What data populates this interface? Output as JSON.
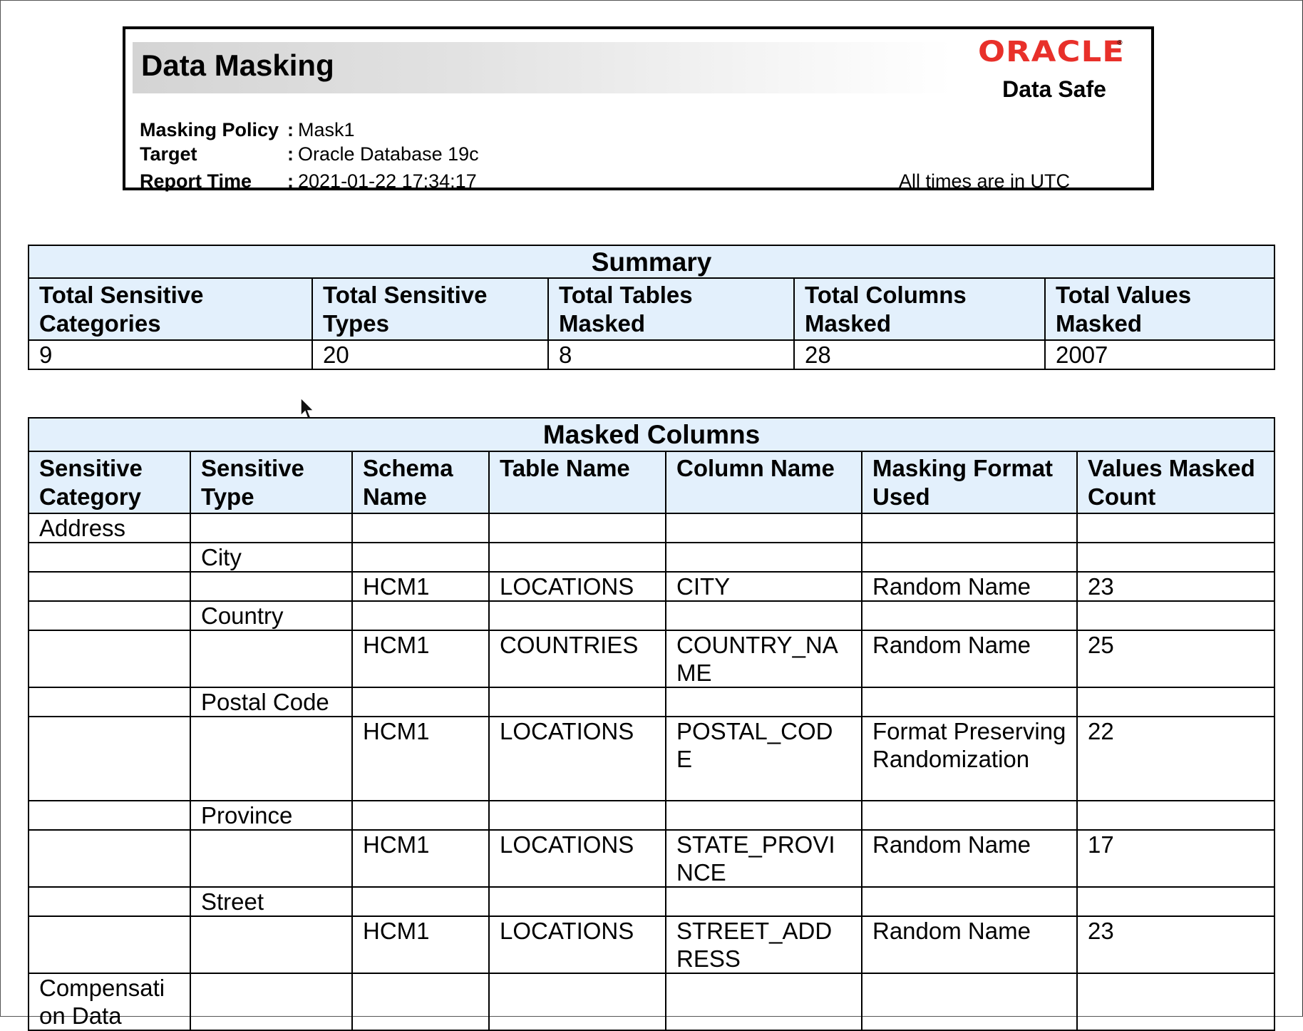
{
  "header": {
    "title": "Data Masking",
    "logo_word": "ORACLE",
    "logo_tm": "®",
    "product": "Data Safe",
    "meta": [
      {
        "label": "Masking Policy",
        "sep": ":",
        "value": "Mask1"
      },
      {
        "label": "Target",
        "sep": ":",
        "value": "Oracle Database 19c"
      },
      {
        "label": "Report Time",
        "sep": ":",
        "value": "2021-01-22 17:34:17"
      }
    ],
    "timezone_note": "All times are in UTC"
  },
  "summary": {
    "caption": "Summary",
    "headers": [
      "Total Sensitive Categories",
      "Total Sensitive Types",
      "Total Tables Masked",
      "Total Columns Masked",
      "Total Values Masked"
    ],
    "values": [
      "9",
      "20",
      "8",
      "28",
      "2007"
    ]
  },
  "masked_columns": {
    "caption": "Masked Columns",
    "headers": [
      "Sensitive Category",
      "Sensitive Type",
      "Schema Name",
      "Table Name",
      "Column Name",
      "Masking Format Used",
      "Values Masked Count"
    ],
    "rows": [
      [
        "Address",
        "",
        "",
        "",
        "",
        "",
        ""
      ],
      [
        "",
        "City",
        "",
        "",
        "",
        "",
        ""
      ],
      [
        "",
        "",
        "HCM1",
        "LOCATIONS",
        "CITY",
        "Random Name",
        "23"
      ],
      [
        "",
        "Country",
        "",
        "",
        "",
        "",
        ""
      ],
      [
        "",
        "",
        "HCM1",
        "COUNTRIES",
        "COUNTRY_NA ME",
        "Random Name",
        "25"
      ],
      [
        "",
        "Postal Code",
        "",
        "",
        "",
        "",
        ""
      ],
      [
        "",
        "",
        "HCM1",
        "LOCATIONS",
        "POSTAL_COD E",
        "Format Preserving Randomization",
        "22"
      ],
      [
        "",
        "Province",
        "",
        "",
        "",
        "",
        ""
      ],
      [
        "",
        "",
        "HCM1",
        "LOCATIONS",
        "STATE_PROVI NCE",
        "Random Name",
        "17"
      ],
      [
        "",
        "Street",
        "",
        "",
        "",
        "",
        ""
      ],
      [
        "",
        "",
        "HCM1",
        "LOCATIONS",
        "STREET_ADD RESS",
        "Random Name",
        "23"
      ],
      [
        "Compensati on Data",
        "",
        "",
        "",
        "",
        "",
        ""
      ]
    ]
  }
}
